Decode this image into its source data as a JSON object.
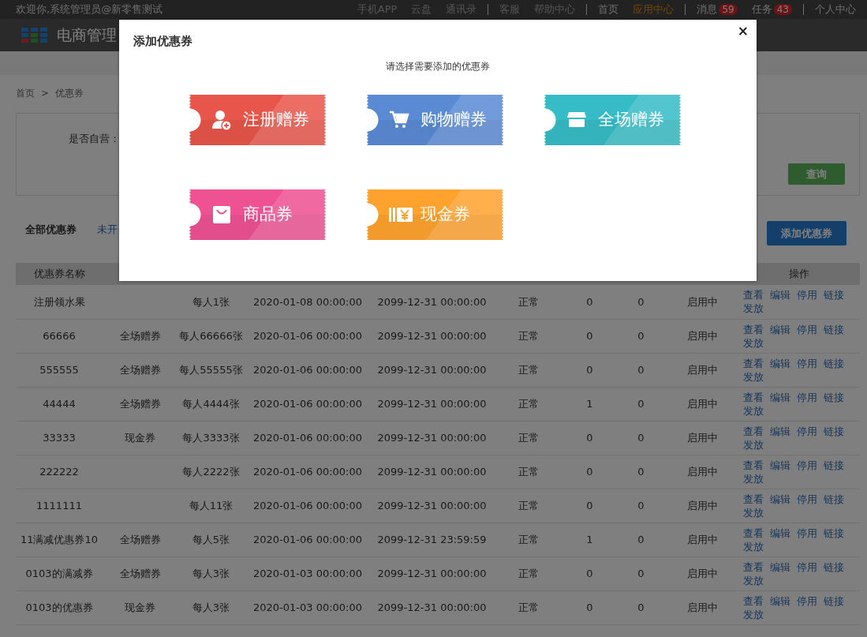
{
  "top_bar": {
    "welcome": "欢迎你,系统管理员@新零售测试",
    "groups": [
      [
        {
          "label": "手机APP",
          "selected": false
        },
        {
          "label": "云盘",
          "selected": false
        },
        {
          "label": "通讯录",
          "selected": false
        }
      ],
      [
        {
          "label": "客服",
          "selected": false
        },
        {
          "label": "帮助中心",
          "selected": false
        }
      ],
      [
        {
          "label": "首页",
          "selected": false
        },
        {
          "label": "应用中心",
          "selected": true
        }
      ],
      [
        {
          "label": "消息",
          "selected": false,
          "badge": "59"
        },
        {
          "label": "任务",
          "selected": false,
          "badge": "43"
        }
      ],
      [
        {
          "label": "个人中心",
          "selected": false
        }
      ]
    ]
  },
  "header": {
    "title": "电商管理"
  },
  "breadcrumb": [
    "首页",
    "优惠券"
  ],
  "breadcrumb_separator": ">",
  "filter": {
    "label": "是否自营：",
    "button": "查询"
  },
  "tabs": [
    {
      "label": "全部优惠券",
      "selected": true
    },
    {
      "label": "未开",
      "selected": false
    }
  ],
  "add_button": "添加优惠券",
  "table": {
    "columns": {
      "first": "优惠券名称",
      "last": "操作"
    },
    "rows": [
      {
        "name": "注册领水果",
        "limit": "每人1张",
        "start": "2020-01-08 00:00:00",
        "end": "2099-12-31 00:00:00",
        "status": "正常",
        "column_7": "0",
        "column_8": "0",
        "state": "启用中",
        "actions": [
          "查看",
          "编辑",
          "停用",
          "链接",
          "发放"
        ]
      },
      {
        "name": "66666",
        "type": "全场赠券",
        "limit": "每人66666张",
        "start": "2020-01-06 00:00:00",
        "end": "2099-12-31 00:00:00",
        "status": "正常",
        "column_7": "0",
        "column_8": "0",
        "state": "启用中",
        "actions": [
          "查看",
          "编辑",
          "停用",
          "链接",
          "发放"
        ]
      },
      {
        "name": "555555",
        "type": "全场赠券",
        "limit": "每人55555张",
        "start": "2020-01-06 00:00:00",
        "end": "2099-12-31 00:00:00",
        "status": "正常",
        "column_7": "0",
        "column_8": "0",
        "state": "启用中",
        "actions": [
          "查看",
          "编辑",
          "停用",
          "链接",
          "发放"
        ]
      },
      {
        "name": "44444",
        "type": "全场赠券",
        "limit": "每人4444张",
        "start": "2020-01-06 00:00:00",
        "end": "2099-12-31 00:00:00",
        "status": "正常",
        "column_7": "1",
        "column_8": "0",
        "state": "启用中",
        "actions": [
          "查看",
          "编辑",
          "停用",
          "链接",
          "发放"
        ]
      },
      {
        "name": "33333",
        "type": "现金券",
        "limit": "每人3333张",
        "start": "2020-01-06 00:00:00",
        "end": "2099-12-31 00:00:00",
        "status": "正常",
        "column_7": "0",
        "column_8": "0",
        "state": "启用中",
        "actions": [
          "查看",
          "编辑",
          "停用",
          "链接",
          "发放"
        ]
      },
      {
        "name": "222222",
        "limit": "每人2222张",
        "start": "2020-01-06 00:00:00",
        "end": "2099-12-31 00:00:00",
        "status": "正常",
        "column_7": "0",
        "column_8": "0",
        "state": "启用中",
        "actions": [
          "查看",
          "编辑",
          "停用",
          "链接",
          "发放"
        ]
      },
      {
        "name": "1111111",
        "limit": "每人11张",
        "start": "2020-01-06 00:00:00",
        "end": "2099-12-31 00:00:00",
        "status": "正常",
        "column_7": "0",
        "column_8": "0",
        "state": "启用中",
        "actions": [
          "查看",
          "编辑",
          "停用",
          "链接",
          "发放"
        ]
      },
      {
        "name": "11满减优惠券10",
        "type": "全场赠券",
        "limit": "每人5张",
        "start": "2020-01-06 00:00:00",
        "end": "2099-12-31 23:59:59",
        "status": "正常",
        "column_7": "1",
        "column_8": "0",
        "state": "启用中",
        "actions": [
          "查看",
          "编辑",
          "停用",
          "链接",
          "发放"
        ]
      },
      {
        "name": "0103的满减券",
        "type": "全场赠券",
        "limit": "每人3张",
        "start": "2020-01-03 00:00:00",
        "end": "2099-12-31 00:00:00",
        "status": "正常",
        "column_7": "0",
        "column_8": "0",
        "state": "启用中",
        "actions": [
          "查看",
          "编辑",
          "停用",
          "链接",
          "发放"
        ]
      },
      {
        "name": "0103的优惠券",
        "type": "现金券",
        "limit": "每人3张",
        "start": "2020-01-03 00:00:00",
        "end": "2099-12-31 00:00:00",
        "status": "正常",
        "column_7": "0",
        "column_8": "0",
        "state": "启用中",
        "actions": [
          "查看",
          "编辑",
          "停用",
          "链接",
          "发放"
        ]
      }
    ]
  },
  "modal": {
    "title": "添加优惠券",
    "close": "×",
    "subtitle": "请选择需要添加的优惠券",
    "coupons": [
      {
        "label": "注册赠券",
        "kind": "register",
        "color": "#e8554a"
      },
      {
        "label": "购物赠券",
        "kind": "shopping",
        "color": "#5a8ad4"
      },
      {
        "label": "全场赠券",
        "kind": "store",
        "color": "#36bcc6"
      },
      {
        "label": "商品券",
        "kind": "product",
        "color": "#ee5292"
      },
      {
        "label": "现金券",
        "kind": "cash",
        "color": "#ffa22e"
      }
    ]
  }
}
